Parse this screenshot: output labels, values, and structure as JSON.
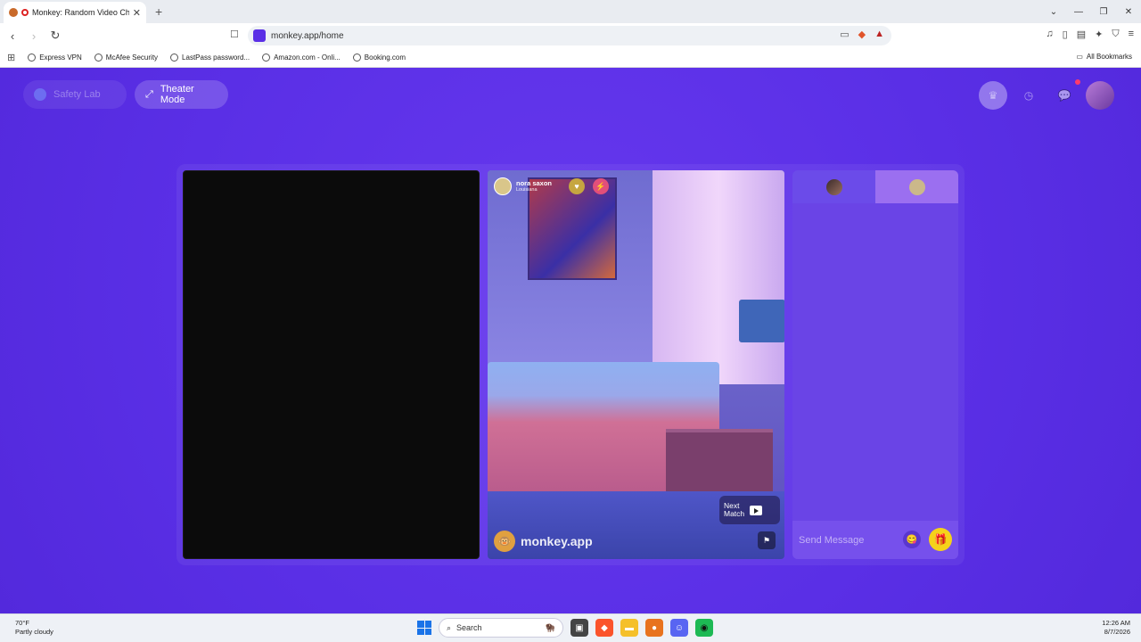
{
  "browser": {
    "tab_title": "Monkey: Random Video Chat",
    "tab_close": "✕",
    "new_tab": "+",
    "url": "monkey.app/home",
    "bookmarks": [
      {
        "label": "Express VPN"
      },
      {
        "label": "McAfee Security"
      },
      {
        "label": "LastPass password..."
      },
      {
        "label": "Amazon.com - Onli..."
      },
      {
        "label": "Booking.com"
      }
    ],
    "all_bookmarks": "All Bookmarks"
  },
  "page": {
    "safety_lab": "Safety Lab",
    "theater_mode": "Theater Mode",
    "match": {
      "name": "nora saxon",
      "location": "Louisiana"
    },
    "brand": "monkey.app",
    "next_match": [
      "Next",
      "Match"
    ],
    "chat_placeholder": "Send Message",
    "accent": "#5a2fe6",
    "gift_color": "#f5d21b"
  },
  "taskbar": {
    "temp": "70°F",
    "weather": "Partly cloudy",
    "search": "Search",
    "time": "12:26 AM",
    "date": "8/7/2026"
  }
}
